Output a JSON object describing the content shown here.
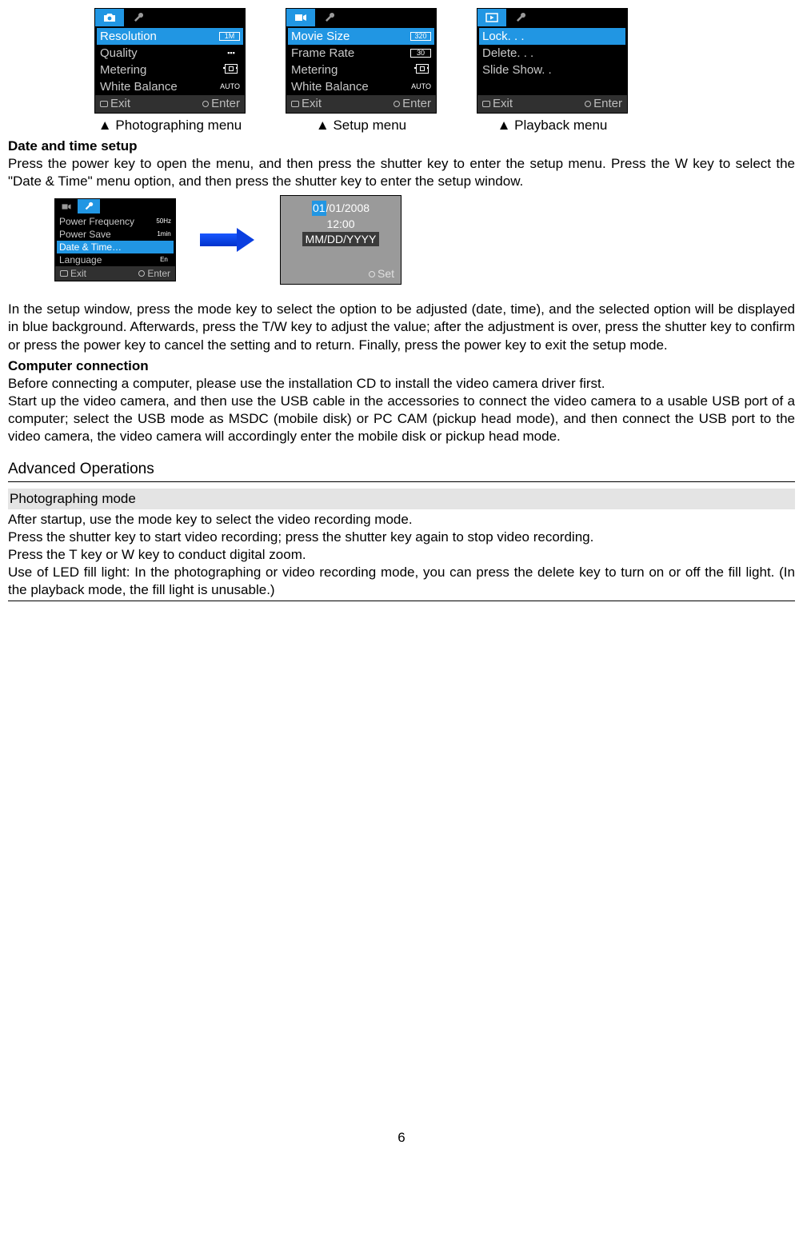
{
  "menus": {
    "photo": {
      "items": [
        {
          "label": "Resolution",
          "val": "1M",
          "sel": true
        },
        {
          "label": "Quality",
          "val": "",
          "sel": false
        },
        {
          "label": "Metering",
          "val": "",
          "sel": false
        },
        {
          "label": "White Balance",
          "val": "AUTO",
          "sel": false
        }
      ],
      "caption": "Photographing menu"
    },
    "setup": {
      "items": [
        {
          "label": "Movie Size",
          "val": "320",
          "sel": true
        },
        {
          "label": "Frame Rate",
          "val": "30",
          "sel": false
        },
        {
          "label": "Metering",
          "val": "",
          "sel": false
        },
        {
          "label": "White Balance",
          "val": "AUTO",
          "sel": false
        }
      ],
      "caption": "Setup menu"
    },
    "playback": {
      "items": [
        {
          "label": "Lock. . .",
          "sel": true
        },
        {
          "label": "Delete. . .",
          "sel": false
        },
        {
          "label": "Slide  Show. .",
          "sel": false
        },
        {
          "label": "",
          "sel": false
        }
      ],
      "caption": "Playback menu"
    },
    "foot_exit": "Exit",
    "foot_enter": "Enter"
  },
  "datetime_menu": {
    "items": [
      {
        "label": "Power Frequency",
        "val": "50Hz",
        "sel": false
      },
      {
        "label": "Power Save",
        "val": "1min",
        "sel": false
      },
      {
        "label": "Date & Time…",
        "val": "",
        "sel": true
      },
      {
        "label": "Language",
        "val": "En",
        "sel": false
      }
    ]
  },
  "dt_panel": {
    "month": "01",
    "rest_date": "/01/2008",
    "time": "12:00",
    "format": "MM/DD/YYYY",
    "set": "Set"
  },
  "headings": {
    "dt": "Date and time setup",
    "cc": "Computer connection",
    "adv": "Advanced Operations",
    "mode": "Photographing mode"
  },
  "text": {
    "dt_p": "Press the power key to open the menu, and then press the shutter key to enter the setup menu. Press the W key to select the \"Date & Time\" menu option, and then press the shutter key to enter the setup window.",
    "setup_p": "In the setup window, press the mode key to select the option to be adjusted (date, time), and the selected option will be displayed in blue background. Afterwards, press the T/W key to adjust the value; after the adjustment is over, press the shutter key to confirm or press the power key to cancel the setting and to return. Finally, press the power key to exit the setup mode.",
    "cc_p1": "Before connecting a computer, please use the installation CD to install the video camera driver first.",
    "cc_p2": "Start up the video camera, and then use the USB cable in the accessories to connect the video camera to a usable USB port of a computer; select the USB mode as MSDC (mobile disk) or PC CAM (pickup head mode), and then connect the USB port to the video camera, the video camera will accordingly enter the mobile disk or pickup head mode.",
    "mode_p1": "After startup, use the mode key to select the video recording mode.",
    "mode_p2": "Press the shutter key to start video recording; press the shutter key again to stop video recording.",
    "mode_p3": "Press the T key or W key to conduct digital zoom.",
    "mode_p4": "Use of LED fill light: In the photographing or video recording mode, you can press the delete key to turn on or off the fill light. (In the playback mode, the fill light is unusable.)"
  },
  "page": "6"
}
